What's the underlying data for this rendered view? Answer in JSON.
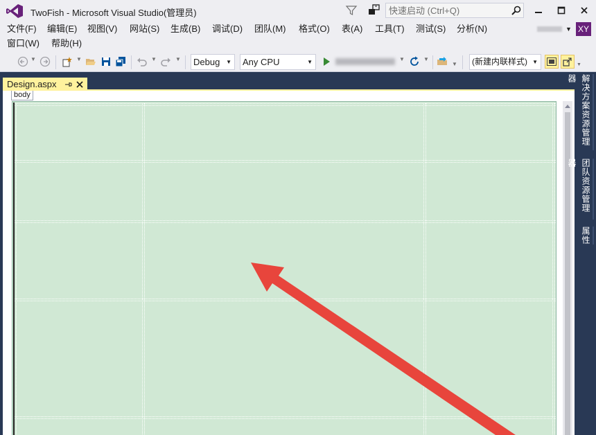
{
  "window": {
    "title": "TwoFish - Microsoft Visual Studio(管理员)",
    "logo_icon": "visual-studio-logo",
    "quick_launch_placeholder": "快速启动 (Ctrl+Q)",
    "controls": [
      "minimize-icon",
      "maximize-icon",
      "close-icon"
    ]
  },
  "menu": {
    "items": [
      "文件(F)",
      "编辑(E)",
      "视图(V)",
      "网站(S)",
      "生成(B)",
      "调试(D)",
      "团队(M)",
      "格式(O)",
      "表(A)",
      "工具(T)",
      "测试(S)",
      "分析(N)"
    ],
    "row2": [
      "窗口(W)",
      "帮助(H)"
    ],
    "avatar_initials": "XY",
    "avatar_color": "#68217a"
  },
  "toolbar": {
    "configuration": "Debug",
    "platform": "Any CPU",
    "style_mode": "(新建内联样式)",
    "icons": [
      "back-icon",
      "forward-icon",
      "new-project-icon",
      "open-icon",
      "save-icon",
      "save-all-icon",
      "undo-icon",
      "redo-icon",
      "start-debug-icon",
      "refresh-icon",
      "browser-link-icon",
      "show-overlay-icon",
      "target-schema-icon"
    ]
  },
  "document": {
    "tab_label": "Design.aspx",
    "tab_color": "#fff29d",
    "selected_tag": "body"
  },
  "side_panel": {
    "tabs": [
      "解决方案资源管理器",
      "团队资源管理器",
      "属性"
    ]
  },
  "colors": {
    "chrome": "#eeeef2",
    "frame": "#293955",
    "table_fill": "#d0e8d4",
    "annotation_arrow": "#e8453c"
  }
}
